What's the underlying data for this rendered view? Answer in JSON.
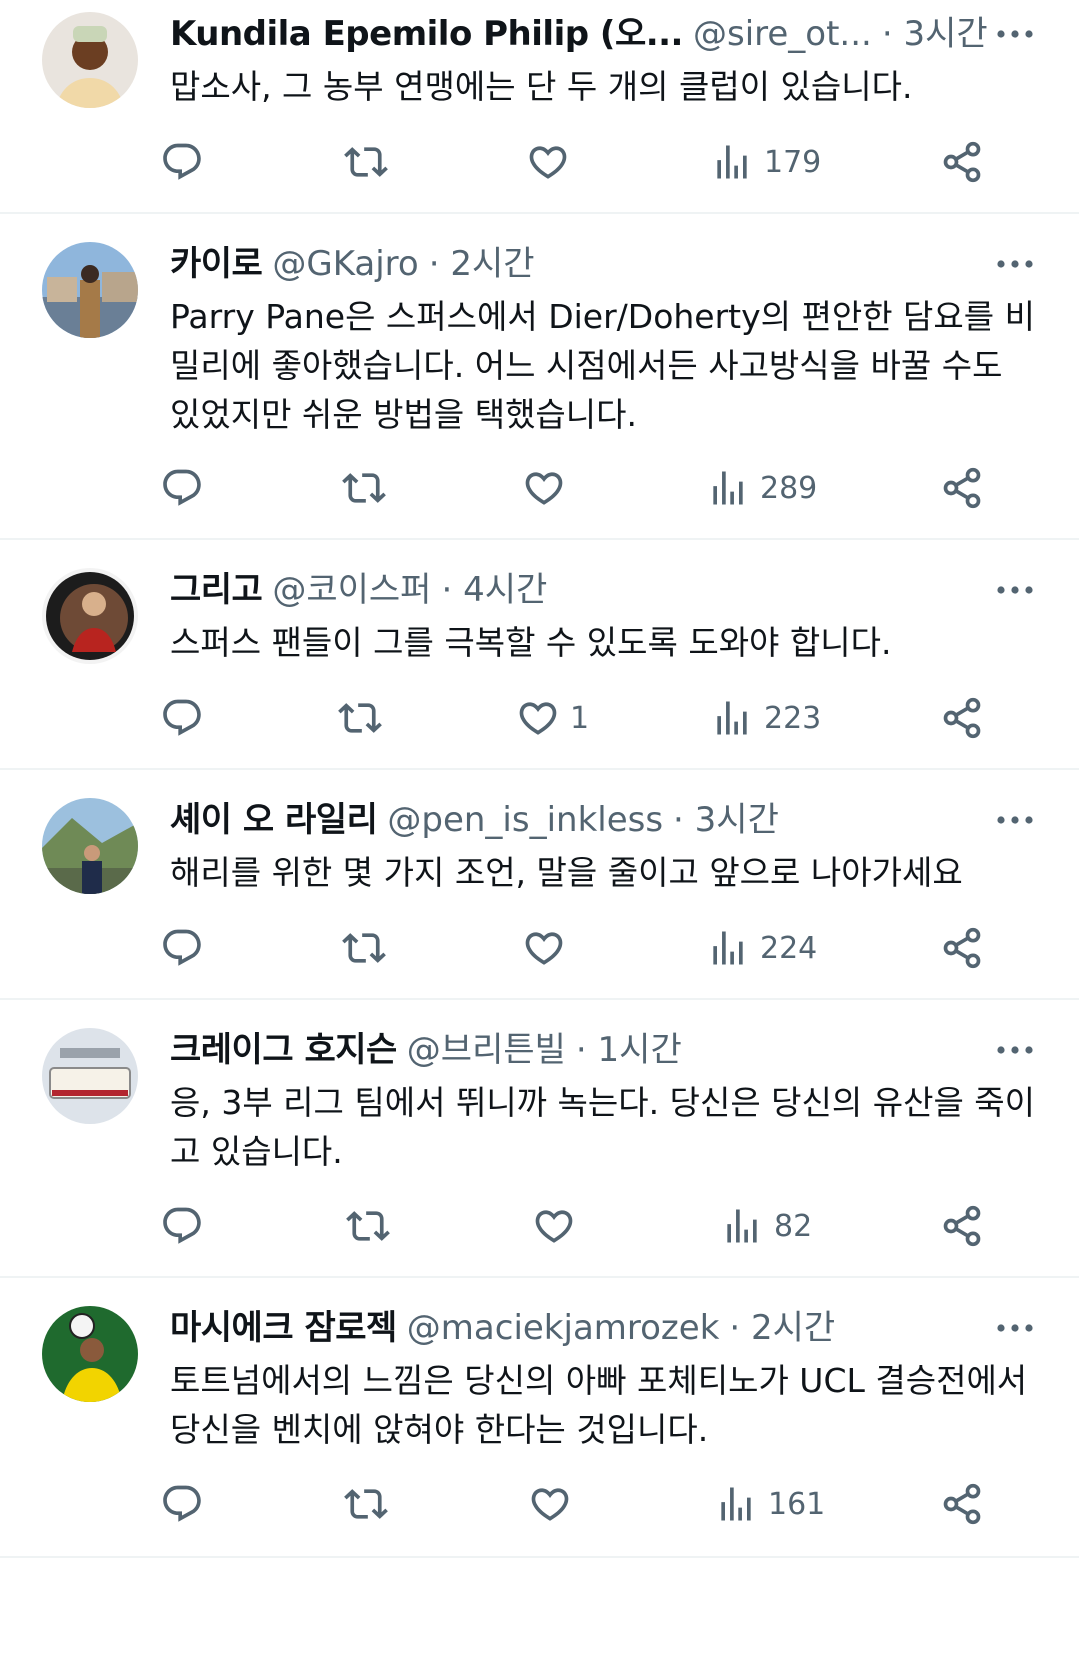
{
  "icons": {
    "reply": "reply-bubble-icon",
    "retweet": "retweet-arrows-icon",
    "like": "heart-icon",
    "views": "bar-chart-icon",
    "share": "share-nodes-icon",
    "more": "more-dots-icon"
  },
  "colors": {
    "text": "#0f1419",
    "meta": "#536471",
    "divider": "#eff3f4"
  },
  "tweets": [
    {
      "name": "Kundila Epemilo Philip (오...",
      "handle": "@sire_ot...",
      "time": "· 3시간",
      "text": "맙소사, 그 농부 연맹에는 단 두 개의 클럽이 있습니다.",
      "likes": "",
      "views": "179"
    },
    {
      "name": "카이로",
      "handle": "@GKajro",
      "time": "· 2시간",
      "text": "Parry Pane은 스퍼스에서 Dier/Doherty의 편안한 담요를 비밀리에 좋아했습니다. 어느 시점에서든 사고방식을 바꿀 수도 있었지만 쉬운 방법을 택했습니다.",
      "likes": "",
      "views": "289"
    },
    {
      "name": "그리고",
      "handle": "@코이스퍼",
      "time": "· 4시간",
      "text": "스퍼스 팬들이 그를 극복할 수 있도록 도와야 합니다.",
      "likes": "1",
      "views": "223"
    },
    {
      "name": "셰이 오 라일리",
      "handle": "@pen_is_inkless",
      "time": "· 3시간",
      "text": "해리를 위한 몇 가지 조언, 말을 줄이고 앞으로 나아가세요",
      "likes": "",
      "views": "224"
    },
    {
      "name": "크레이그 호지슨",
      "handle": "@브리튼빌",
      "time": "· 1시간",
      "text": "응, 3부 리그 팀에서 뛰니까 녹는다. 당신은 당신의 유산을 죽이고 있습니다.",
      "likes": "",
      "views": "82"
    },
    {
      "name": "마시에크 잠로젝",
      "handle": "@maciekjamrozek",
      "time": "· 2시간",
      "text": "토트넘에서의 느낌은 당신의 아빠 포체티노가 UCL 결승전에서 당신을 벤치에 앉혀야 한다는 것입니다.",
      "likes": "",
      "views": "161"
    }
  ]
}
